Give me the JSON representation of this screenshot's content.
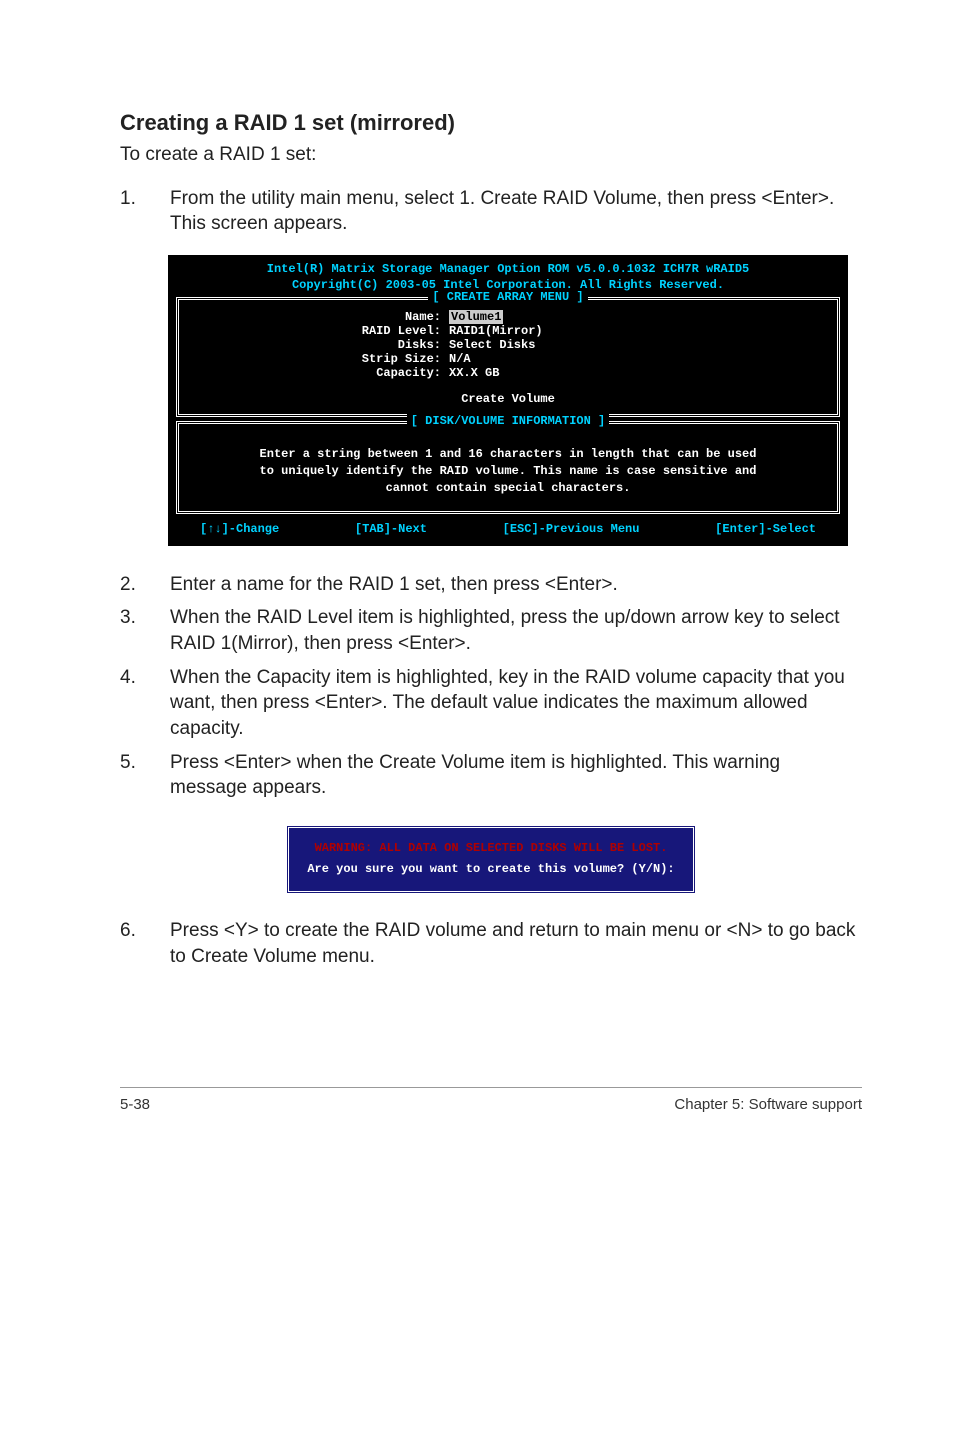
{
  "heading": "Creating a RAID 1 set (mirrored)",
  "intro": "To create a RAID 1 set:",
  "step1": {
    "num": "1.",
    "text": "From the utility main menu, select 1. Create RAID Volume, then press <Enter>. This screen appears."
  },
  "console": {
    "title1": "Intel(R) Matrix Storage Manager Option ROM v5.0.0.1032 ICH7R wRAID5",
    "title2": "Copyright(C) 2003-05 Intel Corporation. All Rights Reserved.",
    "menu_caption": "[ CREATE ARRAY MENU ]",
    "fields": {
      "name_label": "Name:",
      "name_val": "Volume1",
      "raid_label": "RAID Level:",
      "raid_val": "RAID1(Mirror)",
      "disks_label": "Disks:",
      "disks_val": "Select Disks",
      "strip_label": "Strip Size:",
      "strip_val": "N/A",
      "cap_label": "Capacity:",
      "cap_val": "XX.X  GB"
    },
    "create_label": "Create Volume",
    "info_caption": "[ DISK/VOLUME INFORMATION ]",
    "hint1": "Enter a string between 1 and 16 characters in length that can be used",
    "hint2": "to uniquely identify the RAID volume. This name is case sensitive and",
    "hint3": "cannot contain special characters.",
    "f1": "[↑↓]-Change",
    "f2": "[TAB]-Next",
    "f3": "[ESC]-Previous Menu",
    "f4": "[Enter]-Select"
  },
  "step2": {
    "num": "2.",
    "text": "Enter a name for the RAID 1 set, then press <Enter>."
  },
  "step3": {
    "num": "3.",
    "text": "When the RAID Level item is highlighted, press the up/down arrow key to select RAID 1(Mirror), then press <Enter>."
  },
  "step4": {
    "num": "4.",
    "text": "When the Capacity item is highlighted, key in the RAID volume capacity that you want, then press <Enter>. The default value indicates the maximum allowed capacity."
  },
  "step5": {
    "num": "5.",
    "text": "Press <Enter> when the Create Volume item is highlighted. This warning message appears."
  },
  "warnbox": {
    "warn": "WARNING: ALL DATA ON SELECTED DISKS WILL BE LOST.",
    "prompt": "Are you sure you want to create this volume? (Y/N):"
  },
  "step6": {
    "num": "6.",
    "text": "Press <Y> to create the RAID volume and return to main menu or <N> to go back to Create Volume menu."
  },
  "footer": {
    "left": "5-38",
    "right": "Chapter 5: Software support"
  }
}
